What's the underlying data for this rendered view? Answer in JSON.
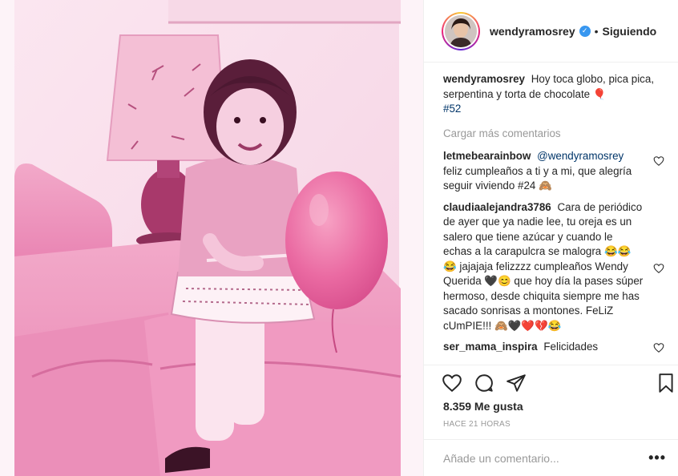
{
  "post": {
    "image_alt": "",
    "accent_colors": {
      "link": "#003569",
      "muted": "#999999",
      "verified": "#3897f0",
      "photo_tint": "#f3b6d2"
    }
  },
  "header": {
    "username": "wendyramosrey",
    "verified_icon": "verified-badge-icon",
    "separator": "•",
    "follow_status": "Siguiendo"
  },
  "caption": {
    "username": "wendyramosrey",
    "text": "Hoy toca globo, pica pica, serpentina y torta de chocolate 🎈",
    "hashtag": "#52"
  },
  "load_more": "Cargar más comentarios",
  "comments": [
    {
      "username": "letmebearainbow",
      "mention": "@wendyramosrey",
      "text": "feliz cumpleaños a ti y a mi, que alegría seguir viviendo #24 🙈"
    },
    {
      "username": "claudiaalejandra3786",
      "text": "Cara de periódico de ayer que ya nadie lee, tu oreja es un salero que tiene azúcar y cuando le echas a la carapulcra se malogra 😂😂😂 jajajaja felizzzz cumpleaños Wendy Querida 🖤😊 que hoy día la pases súper hermoso, desde chiquita siempre me has sacado sonrisas a montones. FeLiZ cUmPIE!!! 🙈🖤❤️💔😂"
    },
    {
      "username": "ser_mama_inspira",
      "text": "Felicidades"
    }
  ],
  "actions": {
    "like_icon": "heart-icon",
    "comment_icon": "comment-bubble-icon",
    "share_icon": "share-icon",
    "save_icon": "bookmark-icon"
  },
  "likes": "8.359 Me gusta",
  "timestamp": "HACE 21 HORAS",
  "comment_box": {
    "placeholder": "Añade un comentario...",
    "more_icon": "more-options-icon",
    "more_label": "•••"
  }
}
